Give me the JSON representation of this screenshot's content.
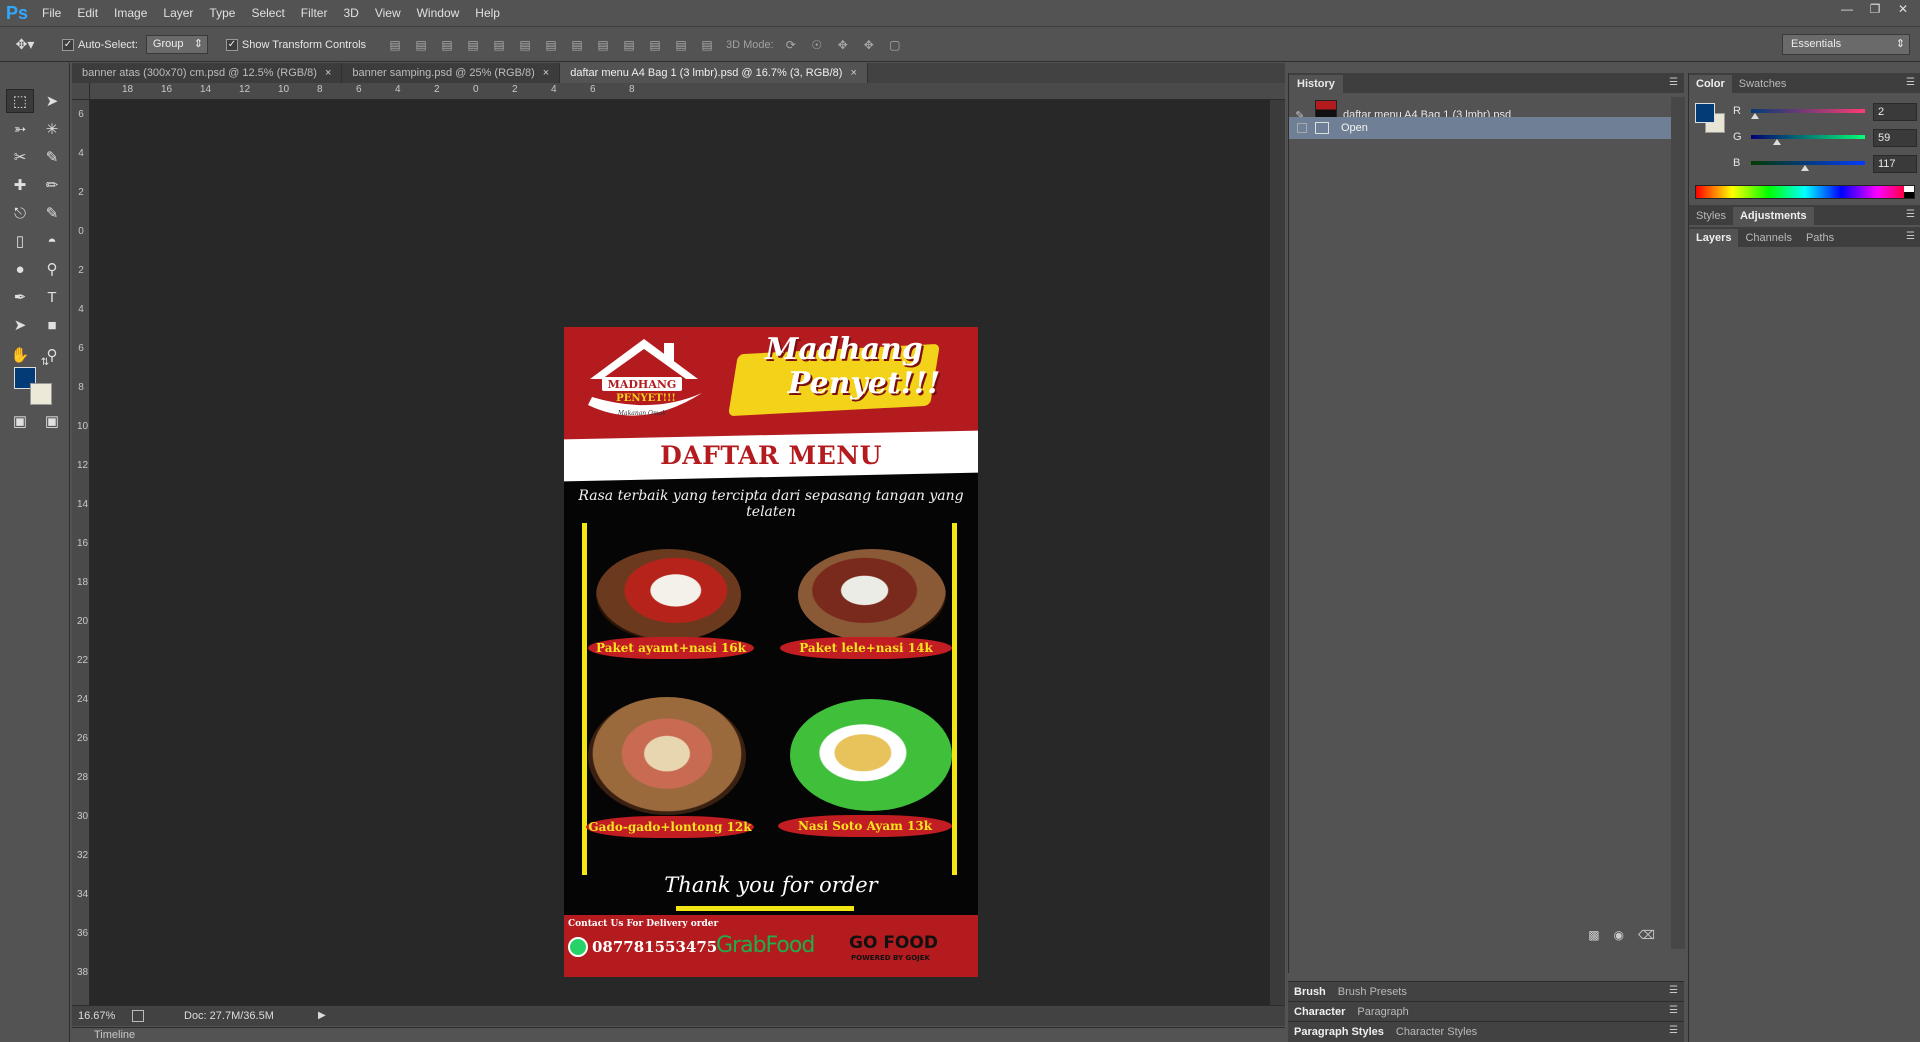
{
  "app": {
    "logo": "Ps"
  },
  "menubar": {
    "items": [
      "File",
      "Edit",
      "Image",
      "Layer",
      "Type",
      "Select",
      "Filter",
      "3D",
      "View",
      "Window",
      "Help"
    ]
  },
  "options": {
    "auto_select_label": "Auto-Select:",
    "group_value": "Group",
    "transform_label": "Show Transform Controls",
    "mode3d_label": "3D Mode:",
    "workspace": "Essentials"
  },
  "tabs": [
    {
      "label": "banner atas (300x70) cm.psd @ 12.5% (RGB/8)",
      "close": "×"
    },
    {
      "label": "banner samping.psd @ 25% (RGB/8)",
      "close": "×"
    },
    {
      "label": "daftar menu A4 Bag 1 (3 lmbr).psd @ 16.7% (3, RGB/8)",
      "close": "×"
    }
  ],
  "ruler_h": [
    "18",
    "16",
    "14",
    "12",
    "10",
    "8",
    "6",
    "4",
    "2",
    "0",
    "2",
    "4",
    "6",
    "8"
  ],
  "ruler_v": [
    "6",
    "4",
    "2",
    "0",
    "2",
    "4",
    "6",
    "8",
    "10",
    "12",
    "14",
    "16",
    "18",
    "20",
    "22",
    "24",
    "26",
    "28",
    "30",
    "32",
    "34",
    "36",
    "38"
  ],
  "document": {
    "brand_line1": "Madhang",
    "brand_line2": "Penyet!!!",
    "logo_text": "MADHANG",
    "logo_sub": "PENYET!!!",
    "logo_tag": "Makanan Omah",
    "heading": "DAFTAR MENU",
    "tagline": "Rasa terbaik yang tercipta dari sepasang tangan  yang telaten",
    "items": [
      {
        "label": "Paket ayamt+nasi 16k"
      },
      {
        "label": "Paket lele+nasi 14k"
      },
      {
        "label": "Gado-gado+lontong 12k"
      },
      {
        "label": "Nasi Soto Ayam 13k"
      }
    ],
    "thanks": "Thank you for order",
    "contact": "Contact Us For Delivery order",
    "phone": "087781553475",
    "grab": "GrabFood",
    "gofood": "GO FOOD",
    "gofood_sub": "POWERED BY GOJEK"
  },
  "status": {
    "zoom": "16.67%",
    "doc": "Doc: 27.7M/36.5M"
  },
  "timeline": {
    "label": "Timeline"
  },
  "history": {
    "tab": "History",
    "snapshot": "daftar menu A4 Bag 1 (3 lmbr).psd",
    "state": "Open"
  },
  "dock": {
    "brush": [
      "Brush",
      "Brush Presets"
    ],
    "character": [
      "Character",
      "Paragraph"
    ],
    "styles": [
      "Paragraph Styles",
      "Character Styles"
    ]
  },
  "right": {
    "color_tabs": [
      "Color",
      "Swatches"
    ],
    "rgb": [
      {
        "label": "R",
        "value": "2"
      },
      {
        "label": "G",
        "value": "59"
      },
      {
        "label": "B",
        "value": "117"
      }
    ],
    "styles_tabs": [
      "Styles",
      "Adjustments"
    ],
    "layers_tabs": [
      "Layers",
      "Channels",
      "Paths"
    ]
  },
  "colors": {
    "foreground": "#023b75",
    "brand_red": "#b31b1f",
    "accent_yellow": "#f3e613"
  }
}
